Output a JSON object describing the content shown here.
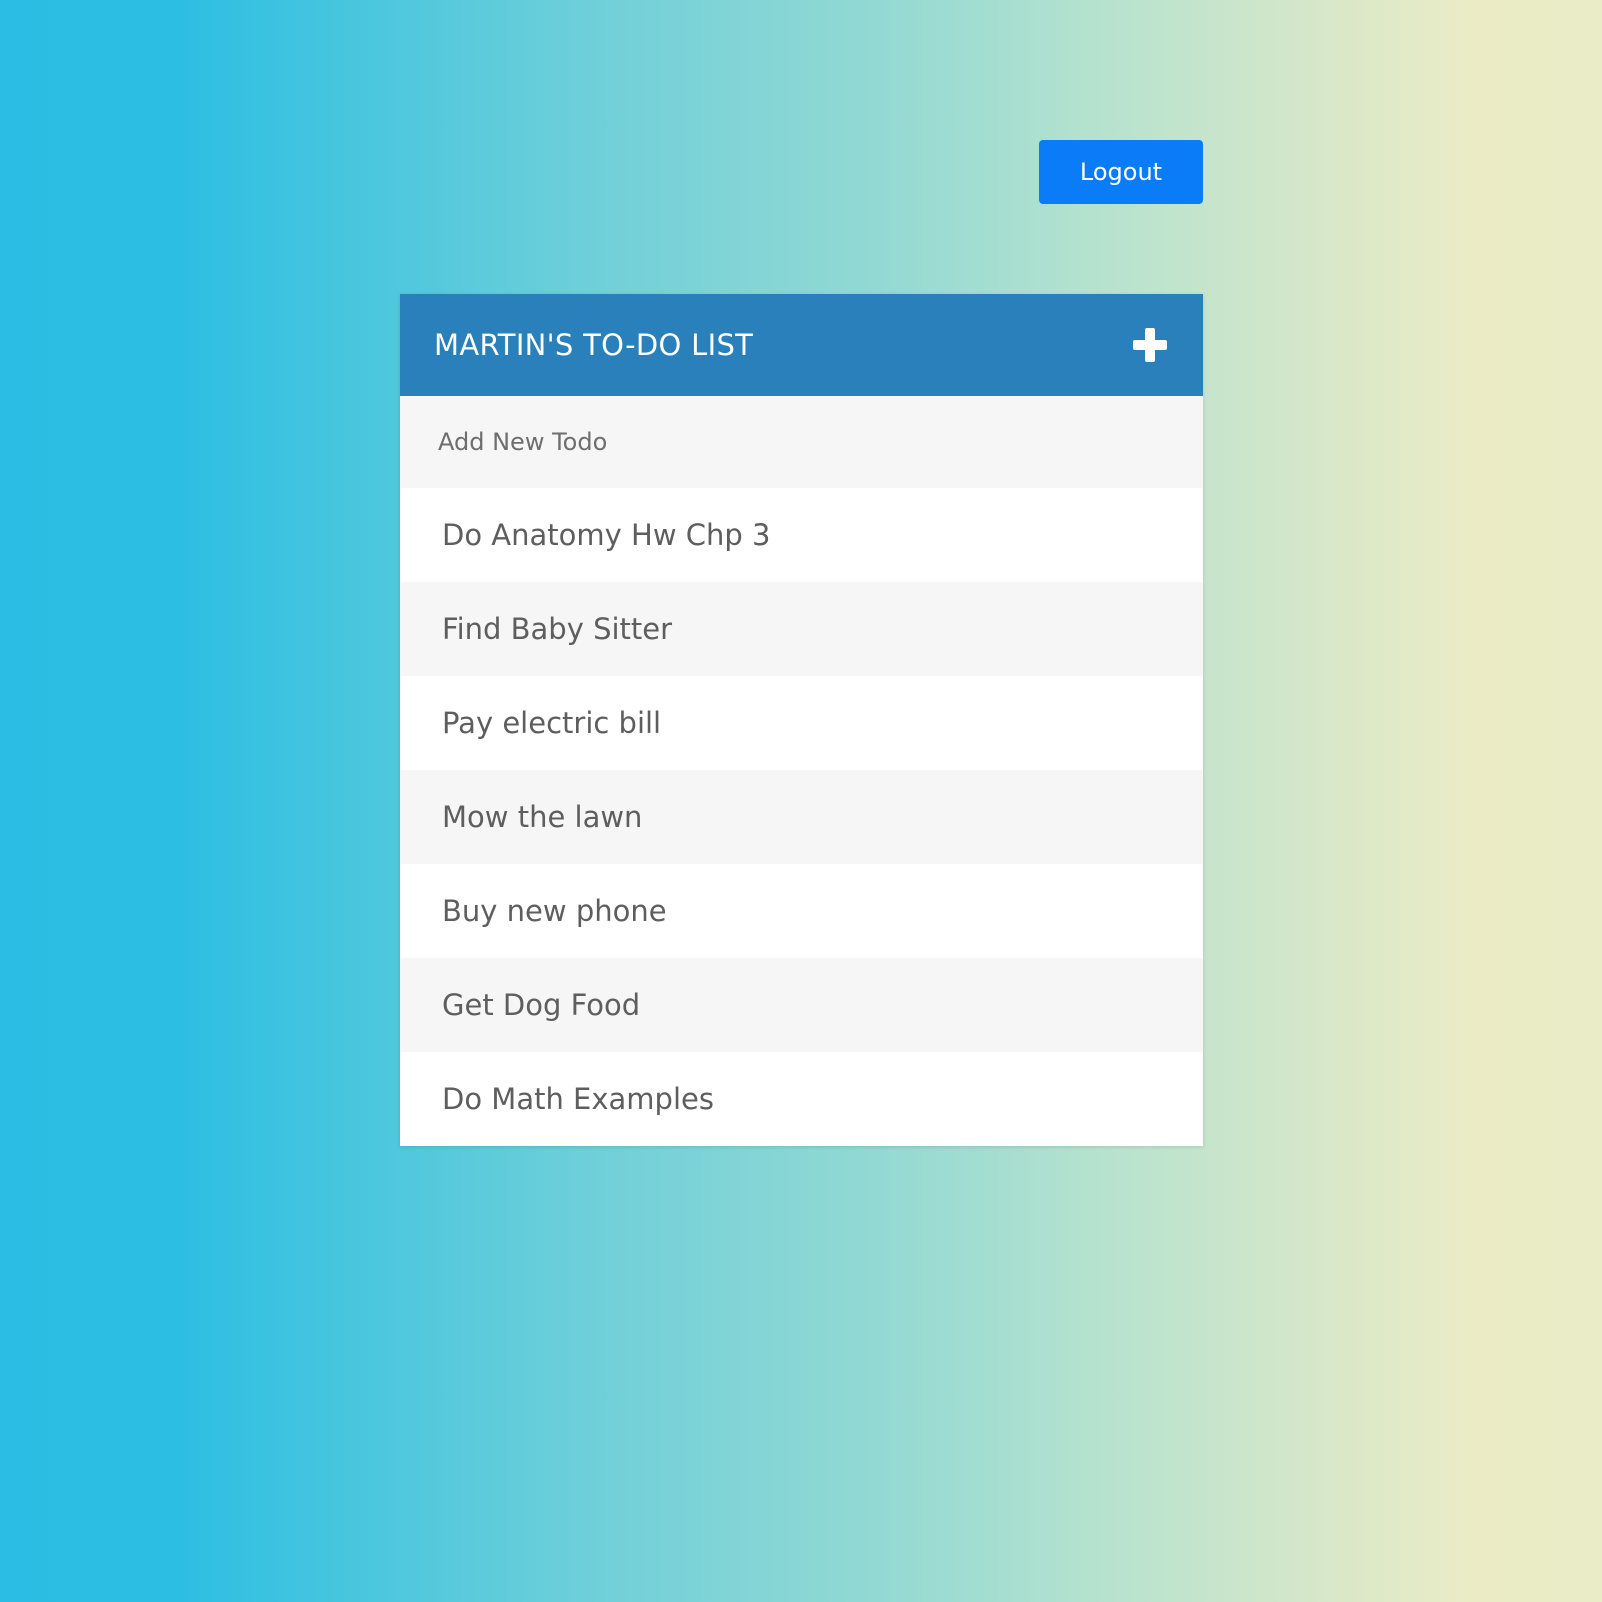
{
  "header": {
    "logout_label": "Logout"
  },
  "todo": {
    "title": "MARTIN'S TO-DO LIST",
    "add_icon": "plus-icon",
    "input_placeholder": "Add New Todo",
    "items": [
      "Do Anatomy Hw Chp 3",
      "Find Baby Sitter",
      "Pay electric bill",
      "Mow the lawn",
      "Buy new phone",
      "Get Dog Food",
      "Do Math Examples"
    ]
  },
  "colors": {
    "header_bg": "#2a80ba",
    "button_bg": "#0a7cf8",
    "gradient_start": "#2bbde3",
    "gradient_end": "#ebecc6"
  }
}
